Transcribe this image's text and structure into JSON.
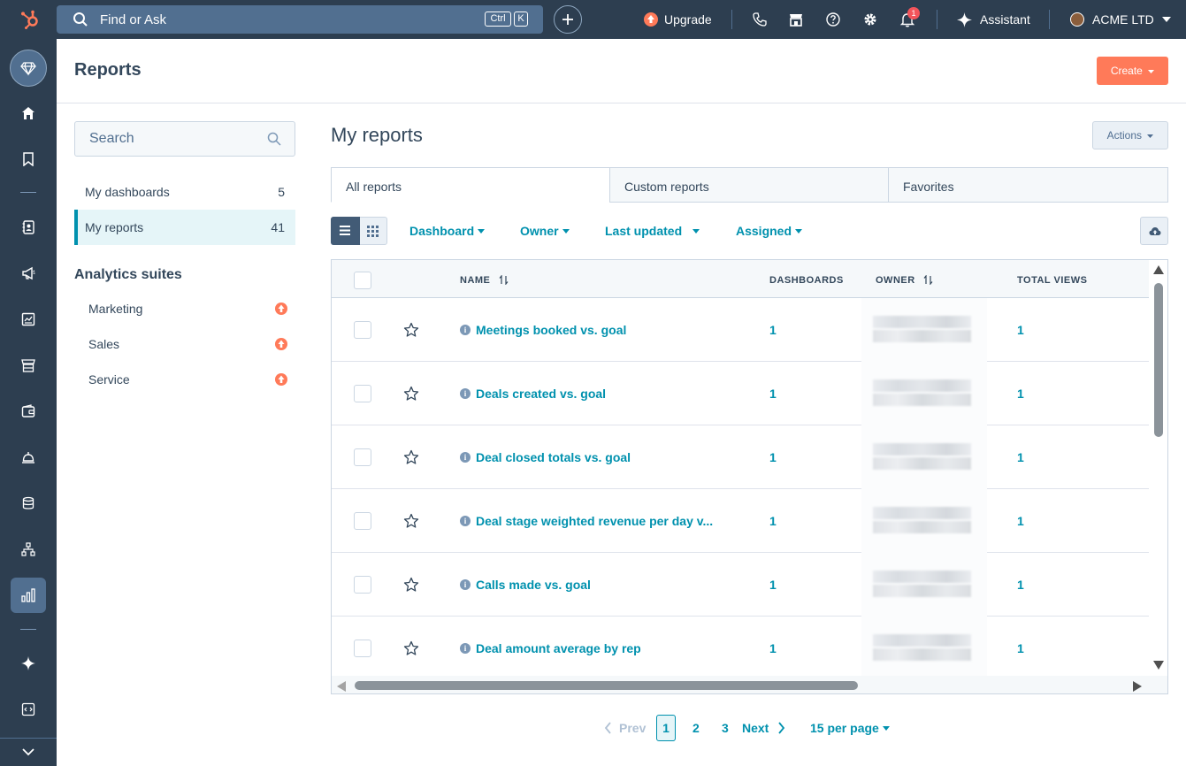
{
  "topbar": {
    "search_placeholder": "Find or Ask",
    "kbd_ctrl": "Ctrl",
    "kbd_k": "K",
    "upgrade_label": "Upgrade",
    "notification_count": "1",
    "assistant_label": "Assistant",
    "account_name": "ACME LTD"
  },
  "header": {
    "title": "Reports",
    "create_label": "Create"
  },
  "sidebar": {
    "search_placeholder": "Search",
    "items": [
      {
        "label": "My dashboards",
        "count": "5"
      },
      {
        "label": "My reports",
        "count": "41"
      }
    ],
    "suites_title": "Analytics suites",
    "suites": [
      {
        "label": "Marketing"
      },
      {
        "label": "Sales"
      },
      {
        "label": "Service"
      }
    ]
  },
  "main": {
    "title": "My reports",
    "actions_label": "Actions",
    "tabs": [
      {
        "label": "All reports"
      },
      {
        "label": "Custom reports"
      },
      {
        "label": "Favorites"
      }
    ],
    "filters": {
      "dashboard": "Dashboard",
      "owner": "Owner",
      "last_updated": "Last updated",
      "assigned": "Assigned"
    },
    "columns": {
      "name": "NAME",
      "dashboards": "DASHBOARDS",
      "owner": "OWNER",
      "total_views": "TOTAL VIEWS"
    },
    "rows": [
      {
        "name": "Meetings booked vs. goal",
        "dashboards": "1",
        "views": "1"
      },
      {
        "name": "Deals created vs. goal",
        "dashboards": "1",
        "views": "1"
      },
      {
        "name": "Deal closed totals vs. goal",
        "dashboards": "1",
        "views": "1"
      },
      {
        "name": "Deal stage weighted revenue per day v...",
        "dashboards": "1",
        "views": "1"
      },
      {
        "name": "Calls made vs. goal",
        "dashboards": "1",
        "views": "1"
      },
      {
        "name": "Deal amount average by rep",
        "dashboards": "1",
        "views": "1"
      }
    ]
  },
  "pagination": {
    "prev": "Prev",
    "pages": [
      "1",
      "2",
      "3"
    ],
    "next": "Next",
    "per_page": "15 per page"
  },
  "colors": {
    "nav_bg": "#2d3e50",
    "accent": "#0091ae",
    "create": "#ff7a59"
  }
}
